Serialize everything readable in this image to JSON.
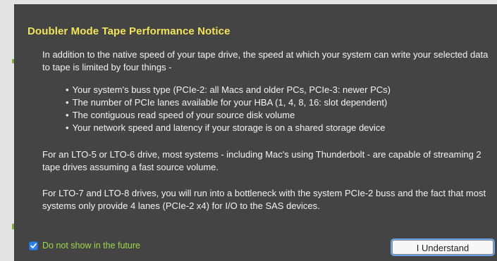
{
  "dialog": {
    "title": "Doubler Mode Tape Performance Notice",
    "intro": "In addition to the native speed of your tape drive, the speed at which your system can write your selected data to tape is limited by four things -",
    "bullets": [
      "Your system's buss type (PCIe-2: all Macs and older PCs, PCIe-3: newer PCs)",
      "The number of PCIe lanes available for your HBA (1, 4, 8, 16: slot dependent)",
      "The contiguous read speed of your source disk volume",
      "Your network speed and latency if your storage is on a shared storage device"
    ],
    "bullet_glyph": "•",
    "para_lto56": "For an LTO-5 or LTO-6 drive, most systems - including Mac's using Thunderbolt - are capable of streaming 2 tape drives assuming a fast source volume.",
    "para_lto78": "For LTO-7 and LTO-8 drives, you will run into a bottleneck with the system PCIe-2 buss and the fact that most systems only provide 4 lanes (PCIe-2 x4) for I/O to the SAS devices."
  },
  "footer": {
    "checkbox_label": "Do not show in the future",
    "checkbox_checked": true,
    "button_label": "I Understand"
  },
  "colors": {
    "dialog_bg": "#444444",
    "title": "#f2e35a",
    "body_text": "#f3f3f3",
    "checkbox_label": "#9fd84a",
    "checkbox_fill": "#2f7fe8",
    "button_focus_ring": "#6aa4ea"
  },
  "icons": {
    "checkbox": "checkmark-icon"
  }
}
